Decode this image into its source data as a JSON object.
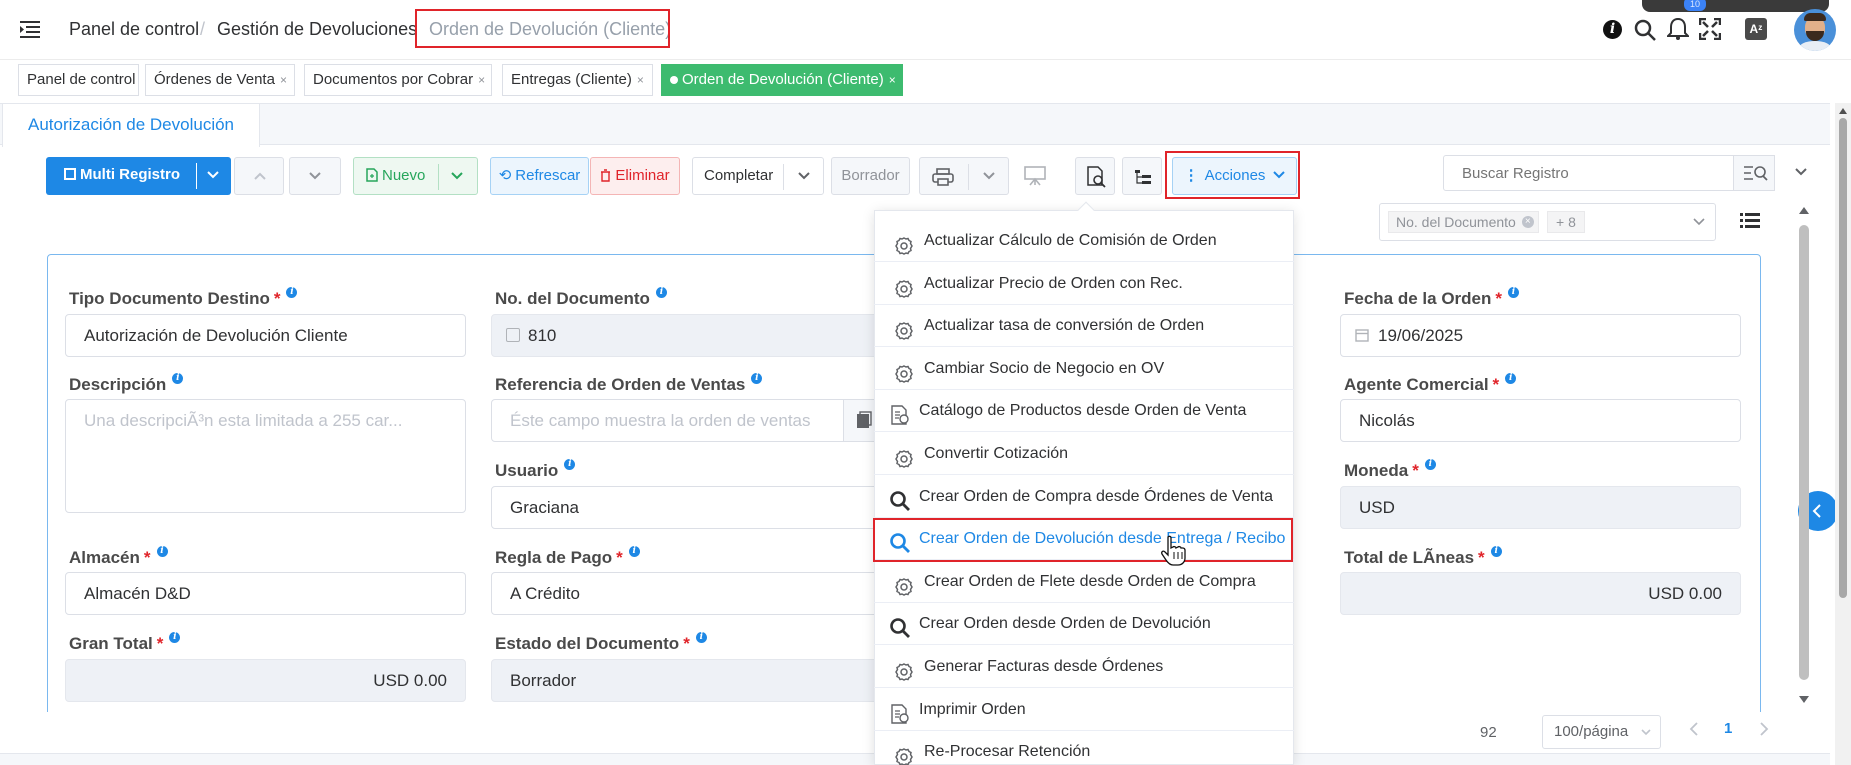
{
  "header": {
    "crumb1": "Panel de control",
    "sep": "/",
    "crumb2": "Gestión de Devoluciones",
    "crumb3": "Orden de Devolución (Cliente)",
    "badge": "10"
  },
  "tabs": [
    {
      "label": "Panel de control"
    },
    {
      "label": "Órdenes de Venta",
      "close": "×"
    },
    {
      "label": "Documentos por Cobrar",
      "close": "×"
    },
    {
      "label": "Entregas (Cliente)",
      "close": "×"
    },
    {
      "label": "Orden de Devolución (Cliente)",
      "close": "×"
    }
  ],
  "subtab": "Autorización de Devolución",
  "toolbar": {
    "multi": "Multi Registro",
    "nuevo": "Nuevo",
    "refrescar": "Refrescar",
    "eliminar": "Eliminar",
    "completar": "Completar",
    "borrador": "Borrador",
    "acciones": "Acciones",
    "search_placeholder": "Buscar Registro"
  },
  "filter": {
    "chip": "No. del Documento",
    "more": "+ 8"
  },
  "form": {
    "tipo_label": "Tipo Documento Destino",
    "tipo_value": "Autorización de Devolución Cliente",
    "nodoc_label": "No. del Documento",
    "nodoc_value": "810",
    "fecha_label": "Fecha de la Orden",
    "fecha_value": "19/06/2025",
    "desc_label": "Descripción",
    "desc_placeholder": "Una descripciÃ³n esta limitada a 255 car...",
    "ref_label": "Referencia de Orden de Ventas",
    "ref_placeholder": "Éste campo muestra la orden de ventas",
    "agente_label": "Agente Comercial",
    "agente_value": "Nicolás",
    "usuario_label": "Usuario",
    "usuario_value": "Graciana",
    "moneda_label": "Moneda",
    "moneda_value": "USD",
    "almacen_label": "Almacén",
    "almacen_value": "Almacén D&D",
    "regla_label": "Regla de Pago",
    "regla_value": "A Crédito",
    "total_lineas_label": "Total de LÃneas",
    "total_lineas_value": "USD 0.00",
    "gran_total_label": "Gran Total",
    "gran_total_value": "USD 0.00",
    "estado_label": "Estado del Documento",
    "estado_value": "Borrador"
  },
  "menu": [
    {
      "label": "Actualizar Cálculo de Comisión de Orden",
      "icon": "gear-icon"
    },
    {
      "label": "Actualizar Precio de Orden con Rec.",
      "icon": "gear-icon"
    },
    {
      "label": "Actualizar tasa de conversión de Orden",
      "icon": "gear-icon"
    },
    {
      "label": "Cambiar Socio de Negocio en OV",
      "icon": "gear-icon"
    },
    {
      "label": "Catálogo de Productos desde Orden de Venta",
      "icon": "report-icon"
    },
    {
      "label": "Convertir Cotización",
      "icon": "gear-icon"
    },
    {
      "label": "Crear Orden de Compra desde Órdenes de Venta",
      "icon": "search-icon"
    },
    {
      "label": "Crear Orden de Devolución desde Entrega / Recibo",
      "icon": "search-icon"
    },
    {
      "label": "Crear Orden de Flete desde Orden de Compra",
      "icon": "gear-icon"
    },
    {
      "label": "Crear Orden desde Orden de Devolución",
      "icon": "search-icon"
    },
    {
      "label": "Generar Facturas desde Órdenes",
      "icon": "gear-icon"
    },
    {
      "label": "Imprimir Orden",
      "icon": "report-icon"
    },
    {
      "label": "Re-Procesar Retención",
      "icon": "gear-icon"
    }
  ],
  "pagination": {
    "total": "92",
    "size": "100/página",
    "page": "1"
  },
  "colors": {
    "primary": "#1e88e5",
    "green": "#26a65b",
    "red": "#e0242a"
  }
}
